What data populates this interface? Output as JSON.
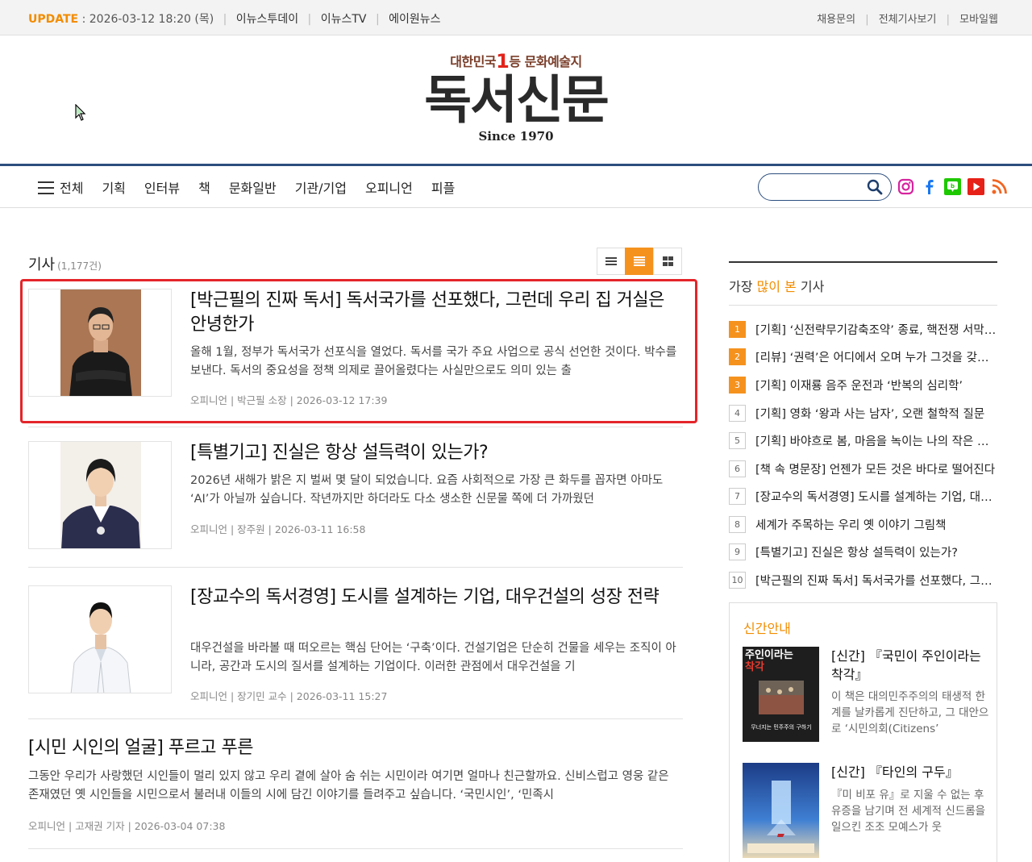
{
  "topbar": {
    "update_label": "UPDATE",
    "update_time": "2026-03-12 18:20 (목)",
    "links": [
      "이뉴스투데이",
      "이뉴스TV",
      "에이원뉴스"
    ],
    "right_links": [
      "채용문의",
      "전체기사보기",
      "모바일웹"
    ]
  },
  "logo": {
    "tagline_pre": "대한민국",
    "tagline_num": "1",
    "tagline_post": "등 문화예술지",
    "name": "독서신문",
    "since": "Since 1970"
  },
  "nav": {
    "all": "전체",
    "items": [
      "기획",
      "인터뷰",
      "책",
      "문화일반",
      "기관/기업",
      "오피니언",
      "피플"
    ]
  },
  "search": {
    "placeholder": ""
  },
  "social_icons": [
    "instagram-icon",
    "facebook-icon",
    "blog-icon",
    "youtube-icon",
    "rss-icon"
  ],
  "list": {
    "heading": "기사",
    "count": "(1,177건)"
  },
  "articles": [
    {
      "title": "[박근필의 진짜 독서] 독서국가를 선포했다, 그런데 우리 집 거실은 안녕한가",
      "summary": "올해 1월, 정부가 독서국가 선포식을 열었다. 독서를 국가 주요 사업으로 공식 선언한 것이다. 박수를 보낸다. 독서의 중요성을 정책 의제로 끌어올렸다는 사실만으로도 의미 있는 출",
      "meta": "오피니언 | 박근필 소장 | 2026-03-12 17:39"
    },
    {
      "title": "[특별기고] 진실은 항상 설득력이 있는가?",
      "summary": "2026년 새해가 밝은 지 벌써 몇 달이 되었습니다. 요즘 사회적으로 가장 큰 화두를 꼽자면 아마도 ‘AI’가 아닐까 싶습니다. 작년까지만 하더라도 다소 생소한 신문물 쪽에 더 가까웠던",
      "meta": "오피니언 | 장주원 | 2026-03-11 16:58"
    },
    {
      "title": "[장교수의 독서경영] 도시를 설계하는 기업, 대우건설의 성장 전략",
      "summary": "대우건설을 바라볼 때 떠오르는 핵심 단어는 ‘구축’이다. 건설기업은 단순히 건물을 세우는 조직이 아니라, 공간과 도시의 질서를 설계하는 기업이다. 이러한 관점에서 대우건설을 기",
      "meta": "오피니언 | 장기민 교수 | 2026-03-11 15:27"
    },
    {
      "title": "[시민 시인의 얼굴] 푸르고 푸른",
      "summary": "그동안 우리가 사랑했던 시인들이 멀리 있지 않고 우리 곁에 살아 숨 쉬는 시민이라 여기면 얼마나 친근할까요. 신비스럽고 영웅 같은 존재였던 옛 시인들을 시민으로서 불러내 이들의 시에 담긴 이야기를 들려주고 싶습니다. ‘국민시인’, ‘민족시",
      "meta": "오피니언 | 고재권 기자 | 2026-03-04 07:38"
    }
  ],
  "popular": {
    "title_pre": "가장 ",
    "title_em": "많이 본",
    "title_post": " 기사",
    "items": [
      "[기획] ‘신전략무기감축조약’ 종료, 핵전쟁 서막인가",
      "[리뷰] ‘권력’은 어디에서 오며 누가 그것을 갖는가",
      "[기획] 이재룡 음주 운전과 ‘반복의 심리학’",
      "[기획] 영화 ‘왕과 사는 남자’, 오랜 철학적 질문",
      "[기획] 바야흐로 봄, 마음을 녹이는 나의 작은 정원",
      "[책 속 명문장] 언젠가 모든 것은 바다로 떨어진다",
      "[장교수의 독서경영] 도시를 설계하는 기업, 대우건설",
      "세계가 주목하는 우리 옛 이야기 그림책",
      "[특별기고] 진실은 항상 설득력이 있는가?",
      "[박근필의 진짜 독서] 독서국가를 선포했다, 그런데"
    ]
  },
  "new_books": {
    "title": "신간안내",
    "items": [
      {
        "title": "[신간] 『국민이 주인이라는 착각』",
        "summary": "이 책은 대의민주주의의 태생적 한계를 날카롭게 진단하고, 그 대안으로 ‘시민의회(Citizens’",
        "cover_text_top": "주인이라는",
        "cover_text_red": "착각",
        "cover_text_bottom": "무너지는 민주주의 구하기"
      },
      {
        "title": "[신간] 『타인의 구두』",
        "summary": "『미 비포 유』로 지울 수 없는 후유증을 남기며 전 세계적 신드롬을 일으킨 조조 모예스가 웃"
      }
    ]
  },
  "colors": {
    "accent": "#f28c00",
    "nav_border": "#2c4e7e",
    "highlight": "#e4252a"
  }
}
